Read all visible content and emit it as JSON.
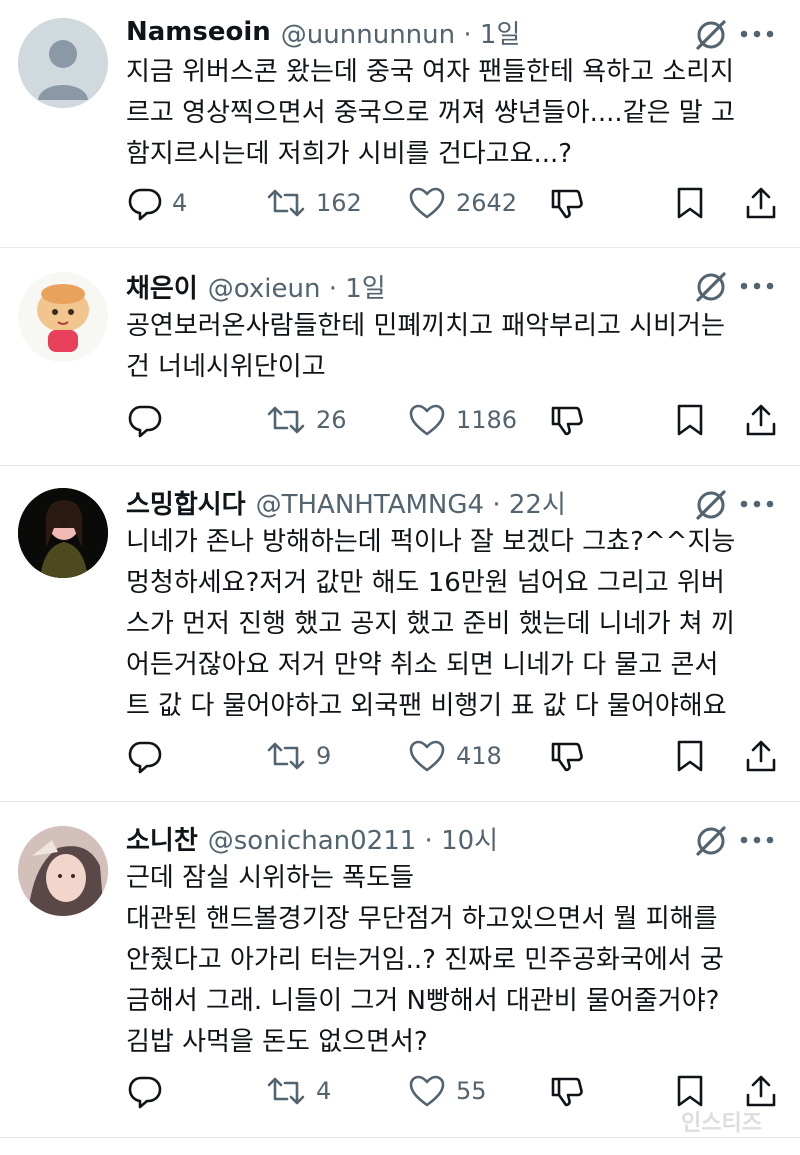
{
  "tweets": [
    {
      "name": "Namseoin",
      "handle": "@uunnunnun",
      "time": "1일",
      "lines": [
        "지금 위버스콘 왔는데 중국 여자 팬들한테 욕하고 소리지",
        "르고 영상찍으면서 중국으로 꺼져 썅년들아....같은 말 고",
        "함지르시는데 저희가 시비를 건다고요...?"
      ],
      "replies": "4",
      "retweets": "162",
      "likes": "2642"
    },
    {
      "name": "채은이",
      "handle": "@oxieun",
      "time": "1일",
      "lines": [
        "공연보러온사람들한테 민폐끼치고 패악부리고 시비거는",
        "건 너네시위단이고"
      ],
      "replies": "",
      "retweets": "26",
      "likes": "1186"
    },
    {
      "name": "스밍합시다",
      "handle": "@THANHTAMNG4",
      "time": "22시",
      "lines": [
        "니네가 존나 방해하는데 퍽이나 잘 보겠다 그쵸?^^지능",
        "멍청하세요?저거 값만 해도 16만원 넘어요 그리고 위버",
        "스가 먼저 진행 했고 공지 했고 준비 했는데 니네가 쳐 끼",
        "어든거잖아요 저거 만약 취소 되면 니네가 다 물고 콘서",
        "트 값 다 물어야하고 외국팬 비행기 표 값 다 물어야해요"
      ],
      "replies": "",
      "retweets": "9",
      "likes": "418"
    },
    {
      "name": "소니찬",
      "handle": "@sonichan0211",
      "time": "10시",
      "lines": [
        "근데 잠실 시위하는 폭도들",
        "대관된 핸드볼경기장 무단점거 하고있으면서 뭘 피해를",
        "안줬다고 아가리 터는거임..? 진짜로 민주공화국에서 궁",
        "금해서 그래. 니들이 그거 N빵해서 대관비 물어줄거야?",
        "김밥 사먹을 돈도 없으면서?"
      ],
      "replies": "",
      "retweets": "4",
      "likes": "55"
    }
  ],
  "watermark": "인스티즈",
  "icons": {
    "reply": "reply-icon",
    "retweet": "retweet-icon",
    "like": "heart-icon",
    "dislike": "thumbs-down-icon",
    "bookmark": "bookmark-icon",
    "share": "share-icon",
    "grok": "grok-icon",
    "more": "more-icon"
  },
  "colors": {
    "text": "#0f1419",
    "secondary": "#536471",
    "divider": "#e6e8ea"
  }
}
